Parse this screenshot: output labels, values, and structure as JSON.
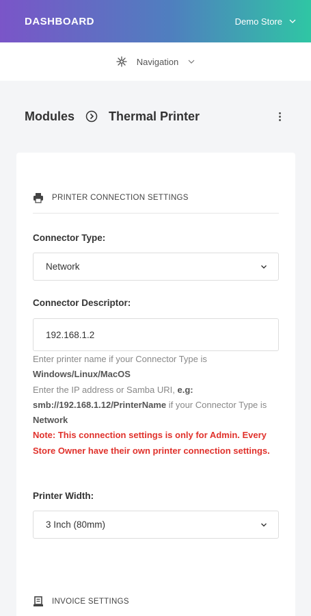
{
  "header": {
    "brand": "DASHBOARD",
    "store": "Demo Store"
  },
  "nav": {
    "label": "Navigation"
  },
  "breadcrumb": {
    "parent": "Modules",
    "current": "Thermal Printer"
  },
  "printer_section": {
    "title": "PRINTER CONNECTION SETTINGS",
    "connector_type": {
      "label": "Connector Type:",
      "value": "Network"
    },
    "connector_descriptor": {
      "label": "Connector Descriptor:",
      "value": "192.168.1.2"
    },
    "help": {
      "line1_text": "Enter printer name if your Connector Type is ",
      "line1_bold": "Windows/Linux/MacOS",
      "line2_text": "Enter the IP address or Samba URI, ",
      "line2_bold1": "e.g: smb://192.168.1.12/PrinterName",
      "line2_text2": " if your Connector Type is ",
      "line2_bold2": "Network",
      "note": "Note: This connection settings is only for Admin. Every Store Owner have their own printer connection settings."
    },
    "printer_width": {
      "label": "Printer Width:",
      "value": "3 Inch (80mm)"
    }
  },
  "invoice_section": {
    "title": "INVOICE SETTINGS"
  },
  "colors": {
    "gradient_start": "#7a55c8",
    "gradient_end": "#2fc6a4",
    "note": "#e0312b"
  }
}
